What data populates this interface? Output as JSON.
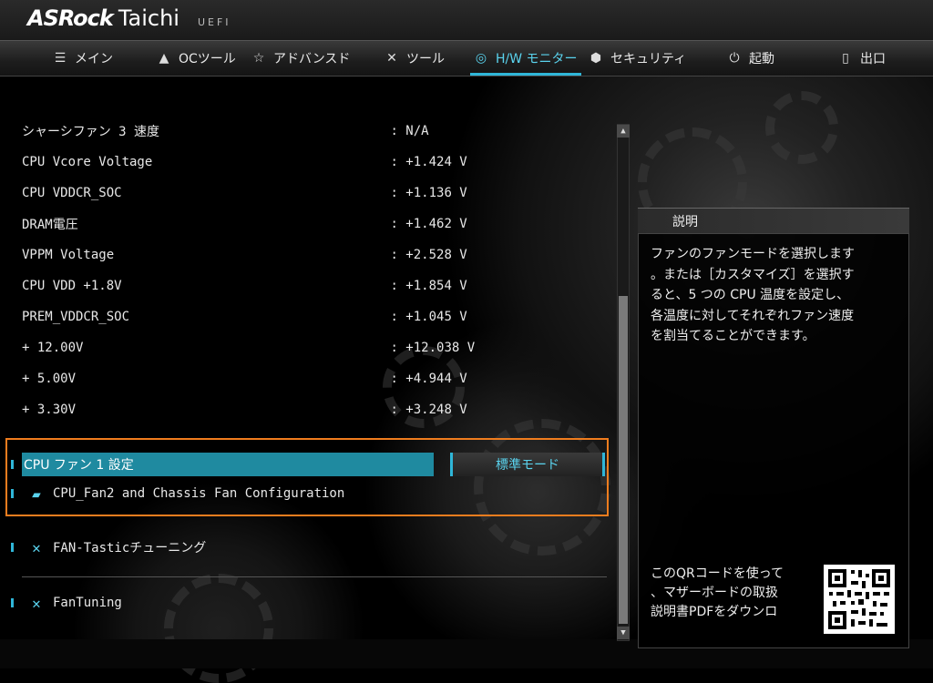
{
  "header": {
    "brand": "ASRock",
    "model": "Taichi",
    "uefi": "UEFI"
  },
  "nav": {
    "tabs": [
      {
        "label": "メイン",
        "icon": "list-icon"
      },
      {
        "label": "OCツール",
        "icon": "rocket-icon"
      },
      {
        "label": "アドバンスド",
        "icon": "star-icon"
      },
      {
        "label": "ツール",
        "icon": "tools-icon"
      },
      {
        "label": "H/W モニター",
        "icon": "monitor-icon",
        "active": true
      },
      {
        "label": "セキュリティ",
        "icon": "shield-icon"
      },
      {
        "label": "起動",
        "icon": "power-icon"
      },
      {
        "label": "出口",
        "icon": "exit-icon"
      }
    ]
  },
  "monitor": {
    "rows": [
      {
        "label": "シャーシファン 3 速度",
        "value": ": N/A"
      },
      {
        "label": "CPU Vcore Voltage",
        "value": ": +1.424 V"
      },
      {
        "label": "CPU VDDCR_SOC",
        "value": ": +1.136 V"
      },
      {
        "label": "DRAM電圧",
        "value": ": +1.462 V"
      },
      {
        "label": "VPPM Voltage",
        "value": ": +2.528 V"
      },
      {
        "label": "CPU VDD +1.8V",
        "value": ": +1.854 V"
      },
      {
        "label": "PREM_VDDCR_SOC",
        "value": ": +1.045 V"
      },
      {
        "label": "+ 12.00V",
        "value": ": +12.038 V"
      },
      {
        "label": "+ 5.00V",
        "value": ": +4.944 V"
      },
      {
        "label": "+ 3.30V",
        "value": ": +3.248 V"
      }
    ]
  },
  "fan": {
    "selected_label": "CPU ファン 1 設定",
    "selected_value": "標準モード",
    "fan2_config": "CPU_Fan2 and Chassis Fan Configuration",
    "fan_tastic": "FAN-Tasticチューニング",
    "fan_tuning": "FanTuning"
  },
  "help": {
    "title": "説明",
    "lines": [
      "ファンのファンモードを選択します",
      "。または［カスタマイズ］を選択す",
      "ると、5 つの CPU 温度を設定し、",
      "各温度に対してそれぞれファン速度",
      "を割当てることができます。"
    ],
    "qr_lines": [
      "このQRコードを使って",
      "、マザーボードの取扱",
      "説明書PDFをダウンロ"
    ]
  },
  "colors": {
    "accent": "#2fb6d8",
    "selection": "#1f8aa0",
    "highlight_frame": "#f07d1e"
  }
}
